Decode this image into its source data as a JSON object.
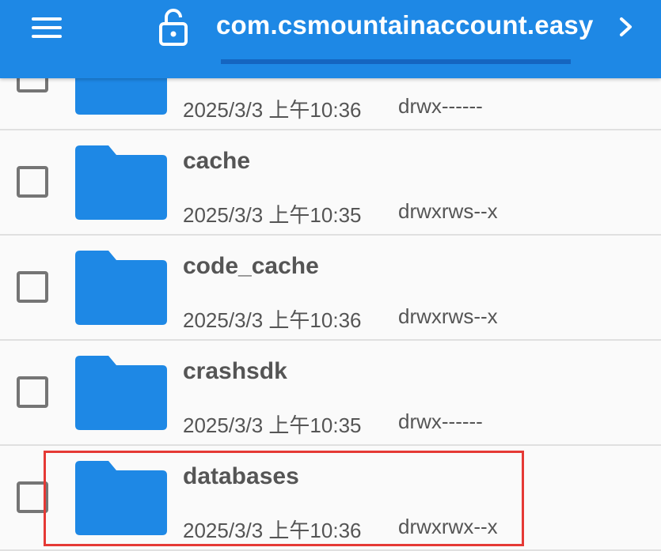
{
  "header": {
    "title": "com.csmountainaccount.easy",
    "menu_icon": "hamburger-menu-icon",
    "lock_icon": "lock-open-icon",
    "next_icon": "chevron-right-icon",
    "color": "#1e88e5"
  },
  "files": [
    {
      "name": "",
      "date": "2025/3/3 上午10:36",
      "perm": "drwx------"
    },
    {
      "name": "cache",
      "date": "2025/3/3 上午10:35",
      "perm": "drwxrws--x"
    },
    {
      "name": "code_cache",
      "date": "2025/3/3 上午10:36",
      "perm": "drwxrws--x"
    },
    {
      "name": "crashsdk",
      "date": "2025/3/3 上午10:35",
      "perm": "drwx------"
    },
    {
      "name": "databases",
      "date": "2025/3/3 上午10:36",
      "perm": "drwxrwx--x"
    }
  ],
  "folder_color": "#1e88e5",
  "highlight_color": "#e53935"
}
